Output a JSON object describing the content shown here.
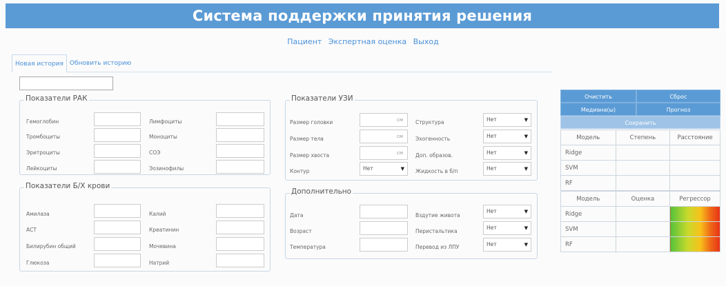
{
  "header": {
    "title": "Система поддержки принятия решения"
  },
  "nav": {
    "links": [
      "Пациент",
      "Экспертная оценка",
      "Выход"
    ]
  },
  "tabs": {
    "new_history": "Новая история",
    "update_history": "Обновить историю"
  },
  "rak": {
    "legend": "Показатели РАК",
    "left_labels": [
      "Гемоглобин",
      "Тромбоциты",
      "Эритроциты",
      "Лейкоциты"
    ],
    "right_labels": [
      "Лимфоциты",
      "Моноциты",
      "СОЭ",
      "Эозинофилы"
    ]
  },
  "blood": {
    "legend": "Показатели Б/Х крови",
    "left_labels": [
      "Амилаза",
      "АСТ",
      "Билирубин общий",
      "Глюкоза"
    ],
    "right_labels": [
      "Калий",
      "Креатинин",
      "Мочевина",
      "Натрий"
    ]
  },
  "uzi": {
    "legend": "Показатели УЗИ",
    "left_labels": [
      "Размер головки",
      "Размер тела",
      "Размер хвоста",
      "Контур"
    ],
    "unit": "см",
    "contour_value": "Нет",
    "right_labels": [
      "Структура",
      "Эхогенность",
      "Доп. образов.",
      "Жидкость в б/п"
    ],
    "right_values": [
      "Нет",
      "Нет",
      "Нет",
      "Нет"
    ]
  },
  "extra": {
    "legend": "Дополнительно",
    "left_labels": [
      "Дата",
      "Возраст",
      "Температура"
    ],
    "right_labels": [
      "Вздутие живота",
      "Перистальтика",
      "Перевод из ЛПУ"
    ],
    "right_values": [
      "Нет",
      "Нет",
      "Нет"
    ]
  },
  "actions": {
    "clear": "Очистить",
    "reset": "Сброс",
    "median": "Медиана(ы)",
    "forecast": "Прогноз",
    "save": "Сохранить"
  },
  "table1": {
    "headers": [
      "Модель",
      "Степень",
      "Расстояние"
    ],
    "rows": [
      "Ridge",
      "SVM",
      "RF"
    ]
  },
  "table2": {
    "headers": [
      "Модель",
      "Оценка",
      "Регрессор"
    ],
    "rows": [
      "Ridge",
      "SVM",
      "RF"
    ]
  },
  "colors": {
    "accent": "#5b9bd5",
    "link": "#4a90d9"
  }
}
